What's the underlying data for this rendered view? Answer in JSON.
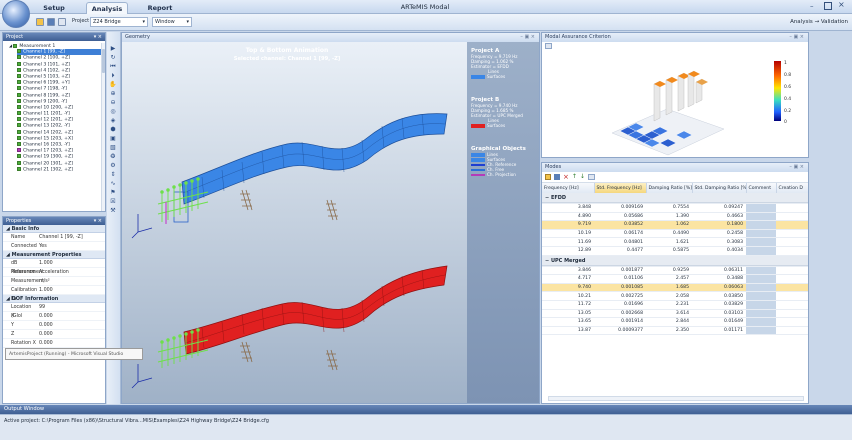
{
  "app": {
    "title": "ARTeMIS Modal",
    "tabs": [
      "Setup",
      "Analysis",
      "Report"
    ],
    "project_label": "Project",
    "project_value": "Z24 Bridge",
    "window_label": "Window",
    "breadcrumb": "Analysis → Validation"
  },
  "project_panel": {
    "title": "Project",
    "root": "Measurement 1",
    "channels": [
      {
        "label": "Channel 1 [99, -Z]",
        "selected": true,
        "color": "green"
      },
      {
        "label": "Channel 2 [100, +Z]",
        "color": "green"
      },
      {
        "label": "Channel 3 [101, +Z]",
        "color": "green"
      },
      {
        "label": "Channel 4 [102, +Z]",
        "color": "green"
      },
      {
        "label": "Channel 5 [103, +Z]",
        "color": "green"
      },
      {
        "label": "Channel 6 [199, +Y]",
        "color": "green"
      },
      {
        "label": "Channel 7 [198, -Y]",
        "color": "green"
      },
      {
        "label": "Channel 8 [199, +Z]",
        "color": "green"
      },
      {
        "label": "Channel 9 [200, -Y]",
        "color": "green"
      },
      {
        "label": "Channel 10 [200, +Z]",
        "color": "green"
      },
      {
        "label": "Channel 11 [201, -Y]",
        "color": "green"
      },
      {
        "label": "Channel 12 [201, +Z]",
        "color": "green"
      },
      {
        "label": "Channel 13 [202, -Y]",
        "color": "green"
      },
      {
        "label": "Channel 14 [202, +Z]",
        "color": "green"
      },
      {
        "label": "Channel 15 [203, +X]",
        "color": "green"
      },
      {
        "label": "Channel 16 [203, -Y]",
        "color": "green"
      },
      {
        "label": "Channel 17 [203, +Z]",
        "color": "magenta"
      },
      {
        "label": "Channel 19 [300, +Z]",
        "color": "green"
      },
      {
        "label": "Channel 20 [301, +Z]",
        "color": "green"
      },
      {
        "label": "Channel 21 [302, +Z]",
        "color": "green"
      }
    ]
  },
  "properties": {
    "title": "Properties",
    "sections": [
      {
        "name": "Basic Info",
        "rows": [
          [
            "Name",
            "Channel 1 [99, -Z]"
          ],
          [
            "Connected",
            "Yes"
          ]
        ]
      },
      {
        "name": "Measurement Properties",
        "rows": [
          [
            "dB Reference",
            "1.000"
          ],
          [
            "Measurement",
            "Acceleration"
          ],
          [
            "Measurement",
            "m/s²"
          ],
          [
            "Calibration Fa",
            "1.000"
          ]
        ]
      },
      {
        "name": "DOF Information",
        "rows": [
          [
            "Location (Glol",
            "99"
          ],
          [
            "X",
            "0.000"
          ],
          [
            "Y",
            "0.000"
          ],
          [
            "Z",
            "0.000"
          ],
          [
            "Rotation X",
            "0.000"
          ]
        ]
      }
    ],
    "tooltip": "ArtemisProject (Running) - Microsoft Visual Studio"
  },
  "geometry": {
    "title": "Geometry",
    "anim_title": "Top & Bottom Animation",
    "anim_subtitle": "Selected channel: Channel 1 [99, -Z]",
    "project_a": {
      "title": "Project A",
      "lines": [
        "Frequency = 9.719 Hz",
        "Damping = 1.062 %",
        "Estimator = EFDD"
      ],
      "surface_color": "#3a86e6"
    },
    "project_b": {
      "title": "Project B",
      "lines": [
        "Frequency = 9.740 Hz",
        "Damping = 1.685 %",
        "Estimator = UPC Merged"
      ],
      "surface_color": "#e02020"
    },
    "legend_items": [
      "Lines",
      "Surfaces"
    ],
    "graphical_title": "Graphical Objects",
    "graphical_items": [
      {
        "label": "Lines",
        "color": "#3a86e6"
      },
      {
        "label": "Surfaces",
        "color": "#3a86e6"
      },
      {
        "label": "Ch. Reference",
        "color": "#1f3fd1"
      },
      {
        "label": "Ch. Free",
        "color": "#2a6fd8"
      },
      {
        "label": "Ch. Projection",
        "color": "#b43bb9"
      }
    ]
  },
  "mac": {
    "title": "Modal Assurance Criterion",
    "scale": [
      "1",
      "0.8",
      "0.6",
      "0.4",
      "0.2",
      "0"
    ]
  },
  "modes": {
    "title": "Modes",
    "columns": [
      "Frequency [Hz]",
      "Std. Frequency [Hz]",
      "Damping Ratio [%]",
      "Std. Damping Ratio [%]",
      "Comment",
      "Creation D"
    ],
    "groups": [
      {
        "name": "EFDD",
        "rows": [
          [
            "3.848",
            "0.009169",
            "0.7554",
            "0.09247",
            ""
          ],
          [
            "4.890",
            "0.05686",
            "1.390",
            "0.4663",
            ""
          ],
          [
            "9.719",
            "0.03852",
            "1.062",
            "0.1800",
            ""
          ],
          [
            "10.19",
            "0.06174",
            "0.4490",
            "0.2458",
            ""
          ],
          [
            "11.69",
            "0.04801",
            "1.621",
            "0.3083",
            ""
          ],
          [
            "12.89",
            "0.4477",
            "0.5875",
            "0.4034",
            ""
          ]
        ],
        "selected": 2
      },
      {
        "name": "UPC Merged",
        "rows": [
          [
            "3.846",
            "0.001877",
            "0.9259",
            "0.06311",
            ""
          ],
          [
            "4.717",
            "0.01106",
            "2.457",
            "0.3488",
            ""
          ],
          [
            "9.740",
            "0.001085",
            "1.685",
            "0.06063",
            ""
          ],
          [
            "10.21",
            "0.002725",
            "2.058",
            "0.03850",
            ""
          ],
          [
            "11.72",
            "0.01696",
            "2.231",
            "0.03829",
            ""
          ],
          [
            "13.05",
            "0.002668",
            "3.614",
            "0.03103",
            ""
          ],
          [
            "13.65",
            "0.001914",
            "2.844",
            "0.01649",
            ""
          ],
          [
            "13.87",
            "0.0009377",
            "2.350",
            "0.01171",
            ""
          ]
        ],
        "selected": 2
      }
    ]
  },
  "output": {
    "title": "Output Window"
  },
  "status": {
    "text": "Active project: C:\\Program Files (x86)\\Structural Vibra...MIS\\Examples\\Z24 Highway Bridge\\Z24 Bridge.cfg"
  }
}
